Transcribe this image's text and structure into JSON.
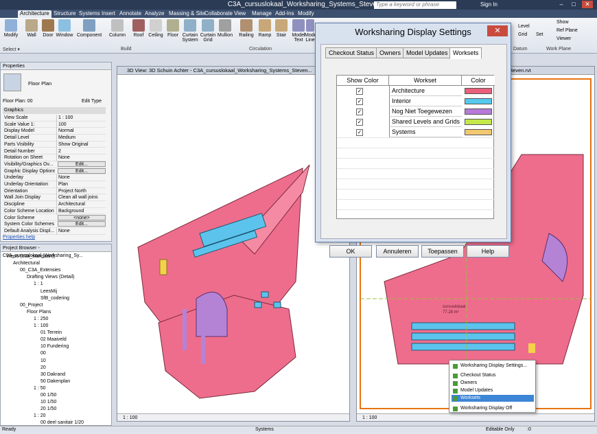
{
  "window": {
    "title": "C3A_cursuslokaal_Worksharing_Systems_Steven.rvt",
    "search_placeholder": "Type a keyword or phrase",
    "sign_in": "Sign In",
    "min": "–",
    "max": "□",
    "close": "✕"
  },
  "tabs": [
    "Architecture",
    "Structure",
    "Systems",
    "Insert",
    "Annotate",
    "Analyze",
    "Massing & Site",
    "Collaborate",
    "View",
    "Manage",
    "Add-Ins",
    "Modify"
  ],
  "ribbon": {
    "buttons": [
      "Modify",
      "Wall",
      "Door",
      "Window",
      "Component",
      "Column",
      "Roof",
      "Ceiling",
      "Floor",
      "Curtain System",
      "Curtain Grid",
      "Mullion",
      "Railing",
      "Ramp",
      "Stair",
      "Model Text",
      "Model Line"
    ],
    "panels": {
      "select": "Select ▾",
      "build": "Build",
      "circulation": "Circulation",
      "datum": "Datum",
      "work_plane": "Work Plane"
    },
    "right": {
      "set": "Set",
      "show": "Show",
      "ref_plane": "Ref Plane",
      "viewer": "Viewer",
      "grid": "Grid",
      "level": "Level"
    }
  },
  "properties": {
    "header": "Properties",
    "type_name": "Floor Plan",
    "instance": "Floor Plan: 00",
    "edit_type": "Edit Type",
    "section": "Graphics",
    "rows": [
      {
        "k": "View Scale",
        "v": "1 : 100"
      },
      {
        "k": "Scale Value    1:",
        "v": "100"
      },
      {
        "k": "Display Model",
        "v": "Normal"
      },
      {
        "k": "Detail Level",
        "v": "Medium"
      },
      {
        "k": "Parts Visibility",
        "v": "Show Original"
      },
      {
        "k": "Detail Number",
        "v": "2"
      },
      {
        "k": "Rotation on Sheet",
        "v": "None"
      },
      {
        "k": "Visibility/Graphics Ov...",
        "v": "Edit..."
      },
      {
        "k": "Graphic Display Options",
        "v": "Edit..."
      },
      {
        "k": "Underlay",
        "v": "None"
      },
      {
        "k": "Underlay Orientation",
        "v": "Plan"
      },
      {
        "k": "Orientation",
        "v": "Project North"
      },
      {
        "k": "Wall Join Display",
        "v": "Clean all wall joins"
      },
      {
        "k": "Discipline",
        "v": "Architectural"
      },
      {
        "k": "Color Scheme Location",
        "v": "Background"
      },
      {
        "k": "Color Scheme",
        "v": "<none>"
      },
      {
        "k": "System Color Schemes",
        "v": "Edit..."
      },
      {
        "k": "Default Analysis Displ...",
        "v": "None"
      }
    ],
    "help": "Properties help"
  },
  "browser": {
    "header": "Project Browser - C3A_cursuslokaal_Worksharing_Sy...",
    "items": [
      {
        "t": "Views (c3a_standaard)",
        "d": 0
      },
      {
        "t": "Architectural",
        "d": 1
      },
      {
        "t": "00_C3A_Extensies",
        "d": 2
      },
      {
        "t": "Drafting Views (Detail)",
        "d": 3
      },
      {
        "t": "1 : 1",
        "d": 4
      },
      {
        "t": "LeesMij",
        "d": 5
      },
      {
        "t": "SfB_codering",
        "d": 5
      },
      {
        "t": "00_Project",
        "d": 2
      },
      {
        "t": "Floor Plans",
        "d": 3
      },
      {
        "t": "1 : 250",
        "d": 4
      },
      {
        "t": "1 : 100",
        "d": 4
      },
      {
        "t": "01 Terrein",
        "d": 5
      },
      {
        "t": "02 Maaiveld",
        "d": 5
      },
      {
        "t": "10 Fundering",
        "d": 5
      },
      {
        "t": "00",
        "d": 5
      },
      {
        "t": "10",
        "d": 5
      },
      {
        "t": "20",
        "d": 5
      },
      {
        "t": "30 Dakrand",
        "d": 5
      },
      {
        "t": "50 Dakenplan",
        "d": 5
      },
      {
        "t": "1 : 50",
        "d": 4
      },
      {
        "t": "00 1/50",
        "d": 5
      },
      {
        "t": "10 1/50",
        "d": 5
      },
      {
        "t": "20 1/50",
        "d": 5
      },
      {
        "t": "1 : 20",
        "d": 4
      },
      {
        "t": "00 deel sanitair 1/20",
        "d": 5
      }
    ]
  },
  "views": {
    "v3d_title": "3D View: 3D Schuin Achter - C3A_cursuslokaal_Worksharing_Systems_Steven...",
    "v3d_scale": "1 : 100",
    "plan_title": "Steven.rvt",
    "plan_scale": "1 : 100",
    "plan_room": "cursuslokaal",
    "plan_area": "77.28 m²"
  },
  "dialog": {
    "title": "Worksharing Display Settings",
    "close": "✕",
    "tabs": [
      "Checkout Status",
      "Owners",
      "Model Updates",
      "Worksets"
    ],
    "active_tab": "Worksets",
    "col_show": "Show Color",
    "col_workset": "Workset",
    "col_color": "Color",
    "rows": [
      {
        "name": "Architecture",
        "checked": "✓",
        "color": "#e8607a"
      },
      {
        "name": "Interior",
        "checked": "✓",
        "color": "#55c8ee"
      },
      {
        "name": "Nog Niet Toegewezen",
        "checked": "✓",
        "color": "#b77ad8"
      },
      {
        "name": "Shared Levels and Grids",
        "checked": "✓",
        "color": "#c4e84a"
      },
      {
        "name": "Systems",
        "checked": "✓",
        "color": "#f2c870"
      }
    ],
    "buttons": {
      "ok": "OK",
      "cancel": "Annuleren",
      "apply": "Toepassen",
      "help": "Help"
    }
  },
  "context_menu": {
    "items": [
      "Worksharing Display Settings...",
      "Checkout Status",
      "Owners",
      "Model Updates",
      "Worksets",
      "Worksharing Display Off"
    ],
    "selected": "Worksets"
  },
  "status": {
    "ready": "Ready",
    "workset": "Systems",
    "editable_only": "Editable Only",
    "scale_value": ":0"
  },
  "colors": {
    "model_pink": "#ee6d8c",
    "interior_blue": "#5cc4ec",
    "purple": "#b483d6",
    "yellow": "#f3d24a",
    "accent": "#3d85d6"
  }
}
